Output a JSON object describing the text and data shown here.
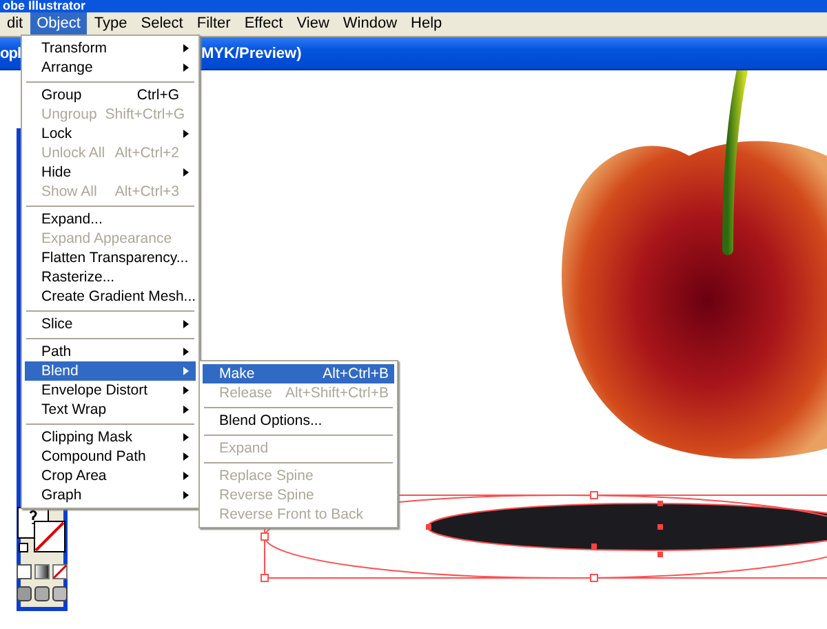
{
  "app_title": "obe Illustrator",
  "menubar": [
    {
      "label": "dit",
      "selected": false
    },
    {
      "label": "Object",
      "selected": true
    },
    {
      "label": "Type",
      "selected": false
    },
    {
      "label": "Select",
      "selected": false
    },
    {
      "label": "Filter",
      "selected": false
    },
    {
      "label": "Effect",
      "selected": false
    },
    {
      "label": "View",
      "selected": false
    },
    {
      "label": "Window",
      "selected": false
    },
    {
      "label": "Help",
      "selected": false
    }
  ],
  "document_title": [
    "opl",
    "MYK/Preview)"
  ],
  "object_menu": [
    {
      "kind": "item",
      "label": "Transform",
      "submenu": true,
      "disabled": false,
      "selected": false
    },
    {
      "kind": "item",
      "label": "Arrange",
      "submenu": true,
      "disabled": false,
      "selected": false
    },
    {
      "kind": "separator"
    },
    {
      "kind": "item",
      "label": "Group",
      "shortcut": "Ctrl+G",
      "submenu": false,
      "disabled": false,
      "selected": false
    },
    {
      "kind": "item",
      "label": "Ungroup",
      "shortcut": "Shift+Ctrl+G",
      "submenu": false,
      "disabled": true,
      "selected": false
    },
    {
      "kind": "item",
      "label": "Lock",
      "submenu": true,
      "disabled": false,
      "selected": false
    },
    {
      "kind": "item",
      "label": "Unlock All",
      "shortcut": "Alt+Ctrl+2",
      "submenu": false,
      "disabled": true,
      "selected": false
    },
    {
      "kind": "item",
      "label": "Hide",
      "submenu": true,
      "disabled": false,
      "selected": false
    },
    {
      "kind": "item",
      "label": "Show All",
      "shortcut": "Alt+Ctrl+3",
      "submenu": false,
      "disabled": true,
      "selected": false
    },
    {
      "kind": "separator"
    },
    {
      "kind": "item",
      "label": "Expand...",
      "submenu": false,
      "disabled": false,
      "selected": false
    },
    {
      "kind": "item",
      "label": "Expand Appearance",
      "submenu": false,
      "disabled": true,
      "selected": false
    },
    {
      "kind": "item",
      "label": "Flatten Transparency...",
      "submenu": false,
      "disabled": false,
      "selected": false
    },
    {
      "kind": "item",
      "label": "Rasterize...",
      "submenu": false,
      "disabled": false,
      "selected": false
    },
    {
      "kind": "item",
      "label": "Create Gradient Mesh...",
      "submenu": false,
      "disabled": false,
      "selected": false
    },
    {
      "kind": "separator"
    },
    {
      "kind": "item",
      "label": "Slice",
      "submenu": true,
      "disabled": false,
      "selected": false
    },
    {
      "kind": "separator"
    },
    {
      "kind": "item",
      "label": "Path",
      "submenu": true,
      "disabled": false,
      "selected": false
    },
    {
      "kind": "item",
      "label": "Blend",
      "submenu": true,
      "disabled": false,
      "selected": true
    },
    {
      "kind": "item",
      "label": "Envelope Distort",
      "submenu": true,
      "disabled": false,
      "selected": false
    },
    {
      "kind": "item",
      "label": "Text Wrap",
      "submenu": true,
      "disabled": false,
      "selected": false
    },
    {
      "kind": "separator"
    },
    {
      "kind": "item",
      "label": "Clipping Mask",
      "submenu": true,
      "disabled": false,
      "selected": false
    },
    {
      "kind": "item",
      "label": "Compound Path",
      "submenu": true,
      "disabled": false,
      "selected": false
    },
    {
      "kind": "item",
      "label": "Crop Area",
      "submenu": true,
      "disabled": false,
      "selected": false
    },
    {
      "kind": "item",
      "label": "Graph",
      "submenu": true,
      "disabled": false,
      "selected": false
    }
  ],
  "blend_submenu": [
    {
      "kind": "item",
      "label": "Make",
      "shortcut": "Alt+Ctrl+B",
      "disabled": false,
      "selected": true
    },
    {
      "kind": "item",
      "label": "Release",
      "shortcut": "Alt+Shift+Ctrl+B",
      "disabled": true,
      "selected": false
    },
    {
      "kind": "separator"
    },
    {
      "kind": "item",
      "label": "Blend Options...",
      "disabled": false,
      "selected": false
    },
    {
      "kind": "separator"
    },
    {
      "kind": "item",
      "label": "Expand",
      "disabled": true,
      "selected": false
    },
    {
      "kind": "separator"
    },
    {
      "kind": "item",
      "label": "Replace Spine",
      "disabled": true,
      "selected": false
    },
    {
      "kind": "item",
      "label": "Reverse Spine",
      "disabled": true,
      "selected": false
    },
    {
      "kind": "item",
      "label": "Reverse Front to Back",
      "disabled": true,
      "selected": false
    }
  ]
}
